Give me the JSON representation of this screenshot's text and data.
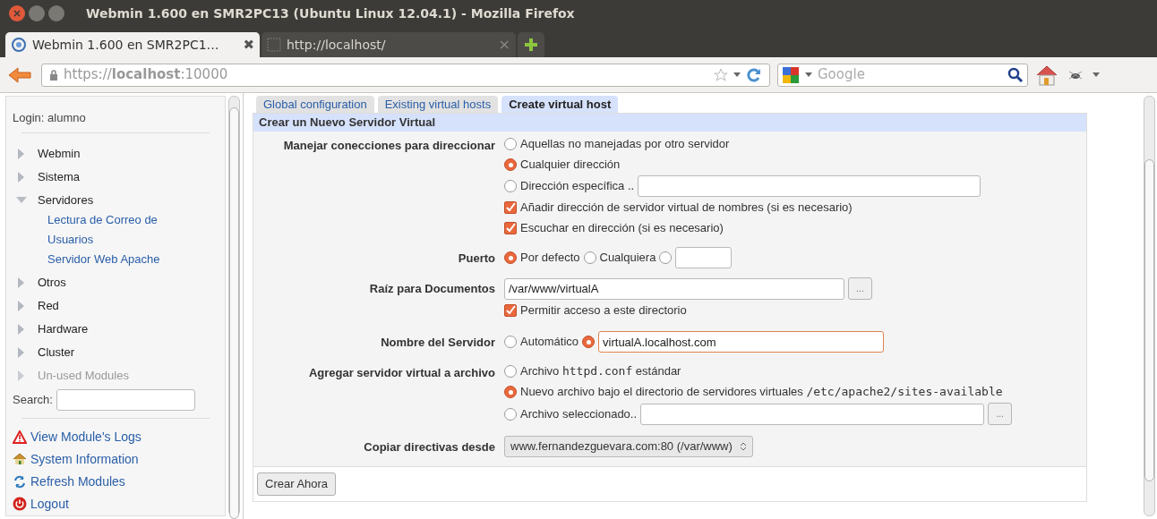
{
  "window": {
    "title": "Webmin 1.600 en SMR2PC13 (Ubuntu Linux 12.04.1) - Mozilla Firefox"
  },
  "browser_tabs": [
    {
      "label": "Webmin 1.600 en SMR2PC1…",
      "selected": true,
      "close": "✖"
    },
    {
      "label": "http://localhost/",
      "selected": false,
      "close": "×"
    }
  ],
  "address_bar": {
    "url": "https://**localhost**:10000"
  },
  "search": {
    "placeholder": "Google"
  },
  "sidebar": {
    "login": "Login: alumno",
    "categories": [
      {
        "label": "Webmin",
        "expanded": false,
        "disabled": false
      },
      {
        "label": "Sistema",
        "expanded": false,
        "disabled": false
      },
      {
        "label": "Servidores",
        "expanded": true,
        "disabled": false,
        "children": [
          "Lectura de Correo de Usuarios",
          "Servidor Web Apache"
        ]
      },
      {
        "label": "Otros",
        "expanded": false,
        "disabled": false
      },
      {
        "label": "Red",
        "expanded": false,
        "disabled": false
      },
      {
        "label": "Hardware",
        "expanded": false,
        "disabled": false
      },
      {
        "label": "Cluster",
        "expanded": false,
        "disabled": false
      },
      {
        "label": "Un-used Modules",
        "expanded": false,
        "disabled": true
      }
    ],
    "search_label": "Search:",
    "links": [
      {
        "kind": "warning",
        "label": "View Module's Logs"
      },
      {
        "kind": "home",
        "label": "System Information"
      },
      {
        "kind": "refresh",
        "label": "Refresh Modules"
      },
      {
        "kind": "power",
        "label": "Logout"
      }
    ]
  },
  "module_tabs": [
    {
      "label": "Global configuration",
      "selected": false
    },
    {
      "label": "Existing virtual hosts",
      "selected": false
    },
    {
      "label": "Create virtual host",
      "selected": true
    }
  ],
  "form": {
    "title": "Crear un Nuevo Servidor Virtual",
    "rows": [
      {
        "label": "Manejar conecciones para direccionar",
        "lines": [
          [
            {
              "kind": "radio",
              "selected": false,
              "parts": [
                {
                  "text": "Aquellas no manejadas por otro servidor"
                }
              ]
            }
          ],
          [
            {
              "kind": "radio",
              "selected": true,
              "parts": [
                {
                  "text": "Cualquier dirección"
                }
              ]
            }
          ],
          [
            {
              "kind": "radio",
              "selected": false,
              "parts": [
                {
                  "text": "Dirección específica .."
                }
              ]
            },
            {
              "kind": "input",
              "focused": false
            }
          ],
          [
            {
              "kind": "checkbox",
              "checked": true,
              "parts": [
                {
                  "text": "Añadir dirección de servidor virtual de nombres (si es necesario)"
                }
              ]
            }
          ],
          [
            {
              "kind": "checkbox",
              "checked": true,
              "parts": [
                {
                  "text": "Escuchar en dirección (si es necesario)"
                }
              ]
            }
          ]
        ]
      },
      {
        "label": "Puerto",
        "lines": [
          [
            {
              "kind": "radio",
              "selected": true,
              "parts": [
                {
                  "text": "Por defecto"
                }
              ]
            },
            {
              "kind": "radio",
              "selected": false,
              "parts": [
                {
                  "text": "Cualquiera"
                }
              ]
            },
            {
              "kind": "radio",
              "selected": false
            },
            {
              "kind": "input",
              "focused": false
            }
          ]
        ]
      },
      {
        "label": "Raíz para Documentos",
        "lines": [
          [
            {
              "kind": "input",
              "focused": false,
              "value": "/var/www/virtualA"
            },
            {
              "kind": "browse",
              "label": "..."
            }
          ],
          [
            {
              "kind": "checkbox",
              "checked": true,
              "parts": [
                {
                  "text": "Permitir acceso a este directorio"
                }
              ]
            }
          ]
        ]
      },
      {
        "label": "Nombre del Servidor",
        "lines": [
          [
            {
              "kind": "radio",
              "selected": false,
              "parts": [
                {
                  "text": "Automático"
                }
              ]
            },
            {
              "kind": "radio",
              "selected": true
            },
            {
              "kind": "input",
              "focused": true,
              "value": "virtualA.localhost.com"
            }
          ]
        ]
      },
      {
        "label": "Agregar servidor virtual a archivo",
        "lines": [
          [
            {
              "kind": "radio",
              "selected": false,
              "parts": [
                {
                  "text": "Archivo "
                },
                {
                  "text": "httpd.conf",
                  "code": true
                },
                {
                  "text": " estándar"
                }
              ]
            }
          ],
          [
            {
              "kind": "radio",
              "selected": true,
              "parts": [
                {
                  "text": "Nuevo archivo bajo el directorio de servidores virtuales "
                },
                {
                  "text": "/etc/apache2/sites-available",
                  "code": true
                }
              ]
            }
          ],
          [
            {
              "kind": "radio",
              "selected": false,
              "parts": [
                {
                  "text": "Archivo seleccionado.."
                }
              ]
            },
            {
              "kind": "input",
              "focused": false
            },
            {
              "kind": "browse",
              "label": "..."
            }
          ]
        ]
      },
      {
        "label": "Copiar directivas desde",
        "lines": [
          [
            {
              "kind": "select",
              "value": "www.fernandezguevara.com:80 (/var/www)"
            }
          ]
        ]
      }
    ]
  },
  "submit": {
    "label": "Crear Ahora"
  }
}
